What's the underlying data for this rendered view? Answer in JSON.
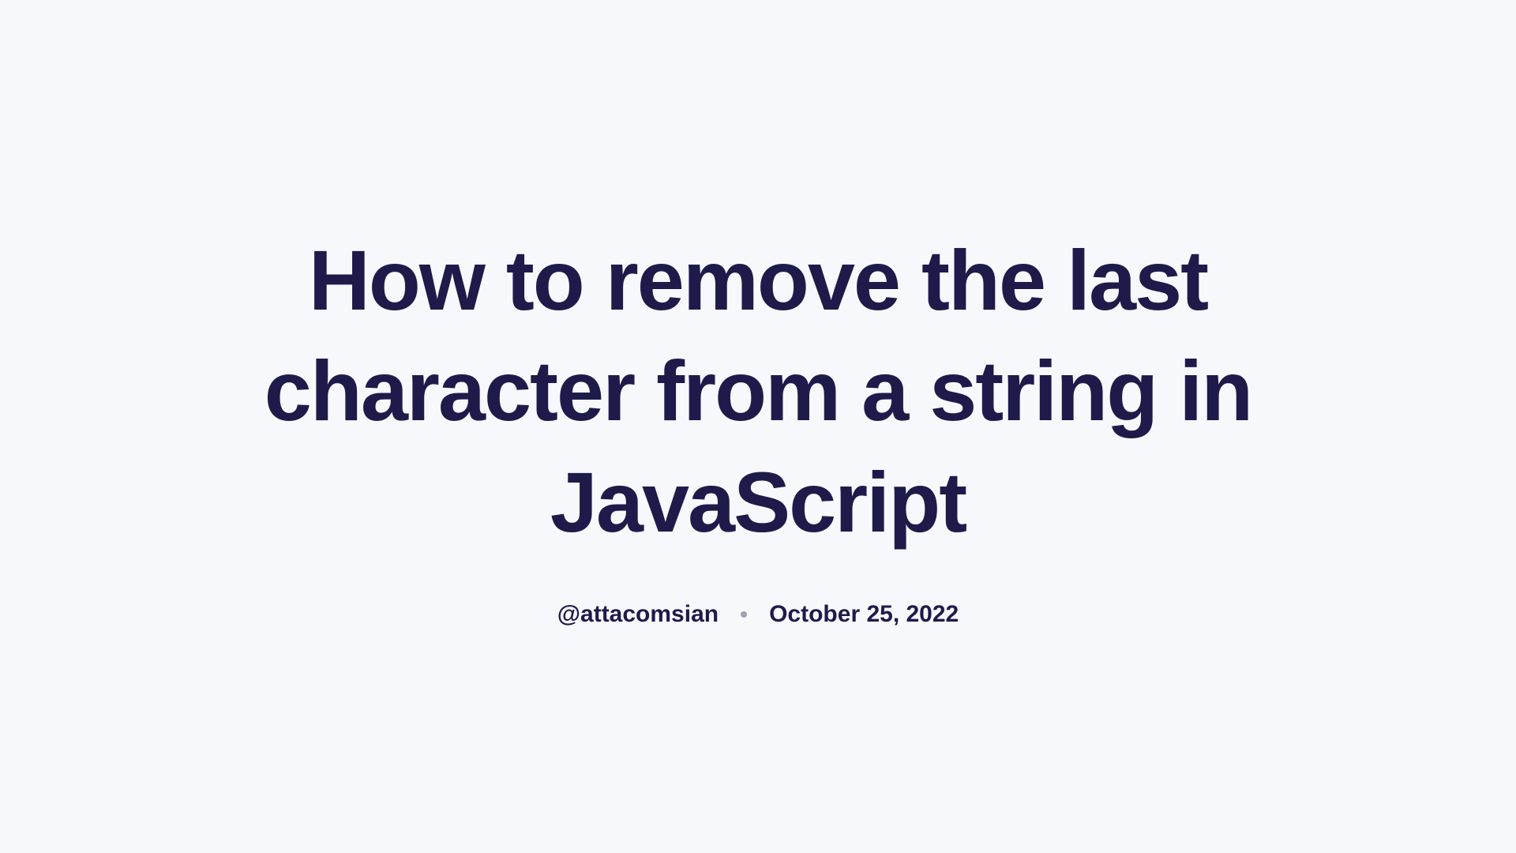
{
  "article": {
    "title": "How to remove the last character from a string in JavaScript",
    "author": "@attacomsian",
    "date": "October 25, 2022"
  }
}
